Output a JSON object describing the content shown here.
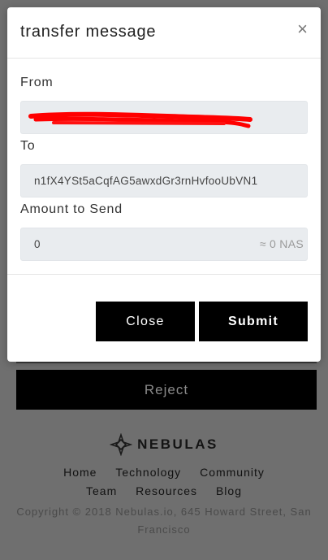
{
  "background": {
    "reject_label": "Reject",
    "brand": {
      "name": "NEBULAS",
      "icon": "nebulas-logo-icon"
    },
    "footer_nav": [
      "Home",
      "Technology",
      "Community",
      "Team",
      "Resources",
      "Blog"
    ],
    "copyright": "Copyright © 2018 Nebulas.io, 645 Howard Street, San Francisco"
  },
  "modal": {
    "title": "transfer message",
    "close_icon": "close-icon",
    "from": {
      "label": "From",
      "value": "n1...",
      "redacted_color": "#ff0000"
    },
    "to": {
      "label": "To",
      "value": "n1fX4YSt5aCqfAG5awxdGr3rnHvfooUbVN1"
    },
    "amount": {
      "label": "Amount to Send",
      "value": "0",
      "suffix": "≈ 0 NAS"
    },
    "buttons": {
      "close_label": "Close",
      "submit_label": "Submit"
    }
  }
}
